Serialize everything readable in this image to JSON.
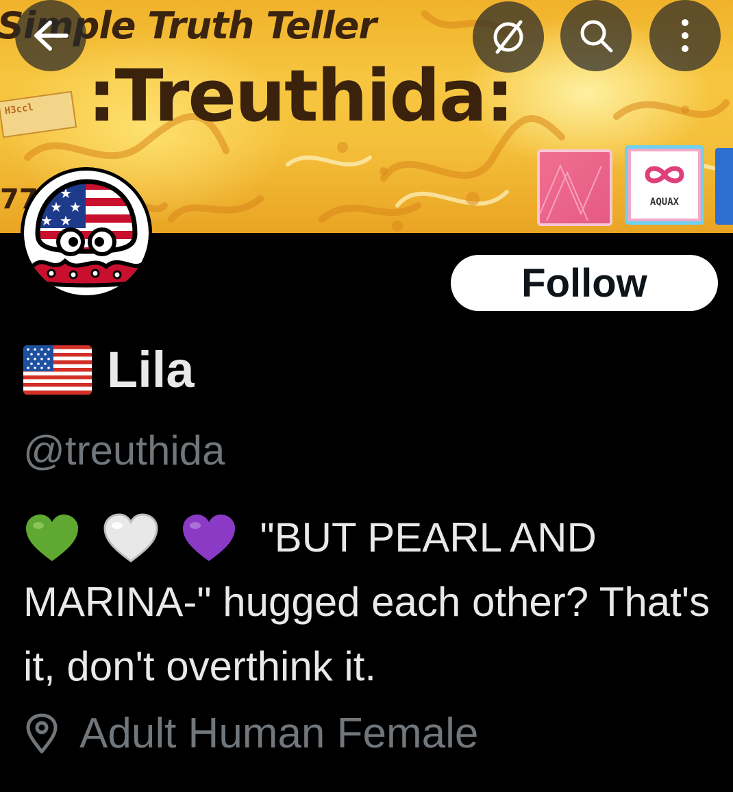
{
  "banner": {
    "caption": "Simple Truth Teller",
    "title": ":Treuthida:",
    "sticker_left": "H3ccl",
    "partial_number": "77",
    "card_aquax_label": "AQUAX",
    "colors": {
      "gold": "#f5c13c",
      "brown": "#3b220d",
      "pink_card": "#e65a82",
      "cyan_border": "#6fd0f0",
      "blue_card": "#2f6fd2"
    }
  },
  "header": {
    "back_icon": "arrow-left-icon",
    "grok_icon": "slashed-circle-icon",
    "search_icon": "search-icon",
    "more_icon": "more-vertical-icon"
  },
  "profile": {
    "avatar_icon": "octopus-us-flag-avatar",
    "follow_label": "Follow",
    "name_flag": "us-flag-emoji",
    "display_name": "Lila",
    "handle": "@treuthida",
    "bio_hearts": [
      "green-heart-emoji",
      "white-heart-emoji",
      "purple-heart-emoji"
    ],
    "bio_text": "\"BUT PEARL AND MARINA-\" hugged each other? That's it, don't overthink it.",
    "location_icon": "location-pin-icon",
    "location": "Adult Human Female"
  },
  "colors": {
    "background": "#000000",
    "primary_text": "#e7e9ea",
    "secondary_text": "#71767b",
    "follow_bg": "#ffffff",
    "follow_text": "#0f1419"
  }
}
